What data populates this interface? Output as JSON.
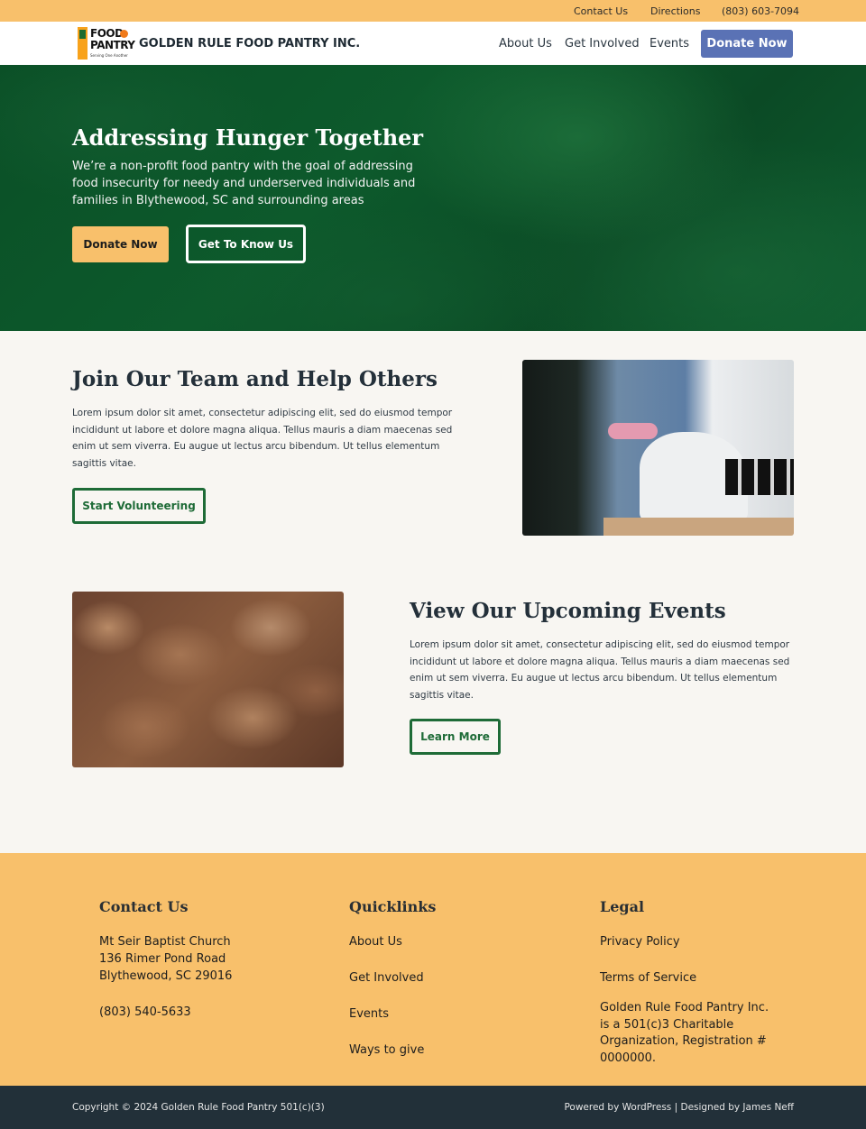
{
  "topbar": {
    "contact": "Contact Us",
    "directions": "Directions",
    "phone": "(803) 603-7094"
  },
  "header": {
    "logo_word1": "FOOD",
    "logo_word2": "PANTRY",
    "logo_tagline": "Serving One Another",
    "brand": "GOLDEN RULE FOOD PANTRY INC.",
    "nav": [
      "About Us",
      "Get Involved",
      "Events"
    ],
    "donate": "Donate Now"
  },
  "hero": {
    "title": "Addressing Hunger Together",
    "text": "We’re a non-profit food pantry with the goal of addressing food insecurity for needy and underserved individuals and families in Blythewood, SC and surrounding areas",
    "donate": "Donate Now",
    "know": "Get To Know Us"
  },
  "volunteer": {
    "title": "Join Our Team and Help Others",
    "text": "Lorem ipsum dolor sit amet, consectetur adipiscing elit, sed do eiusmod  tempor incididunt ut labore et dolore magna aliqua. Tellus mauris a diam  maecenas sed enim ut sem viverra. Eu augue ut lectus arcu bibendum. Ut  tellus elementum sagittis vitae.",
    "button": "Start Volunteering"
  },
  "events": {
    "title": "View Our Upcoming Events",
    "text": "Lorem ipsum dolor sit amet, consectetur adipiscing elit, sed do eiusmod  tempor incididunt ut labore et dolore magna aliqua. Tellus mauris a diam  maecenas sed enim ut sem viverra. Eu augue ut lectus arcu bibendum. Ut  tellus elementum sagittis vitae.",
    "button": "Learn More"
  },
  "footer": {
    "contact": {
      "heading": "Contact Us",
      "address": [
        "Mt Seir Baptist Church",
        "136 Rimer Pond Road",
        "Blythewood, SC 29016"
      ],
      "phone": "(803) 540-5633"
    },
    "quicklinks": {
      "heading": "Quicklinks",
      "links": [
        "About Us",
        "Get Involved",
        "Events",
        "Ways to give"
      ]
    },
    "legal": {
      "heading": "Legal",
      "links": [
        "Privacy Policy",
        "Terms of Service"
      ],
      "note": "Golden Rule Food Pantry Inc. is a 501(c)3 Charitable Organization, Registration # 0000000."
    }
  },
  "bottom": {
    "copyright": "Copyright © 2024 Golden Rule Food Pantry 501(c)(3)",
    "credits": "Powered by WordPress | Designed by James Neff"
  },
  "colors": {
    "accent_yellow": "#f8c06b",
    "hero_green": "#0b4f27",
    "button_blue": "#5a72b5",
    "outline_green": "#1e6b37",
    "footer_dark": "#223039"
  }
}
